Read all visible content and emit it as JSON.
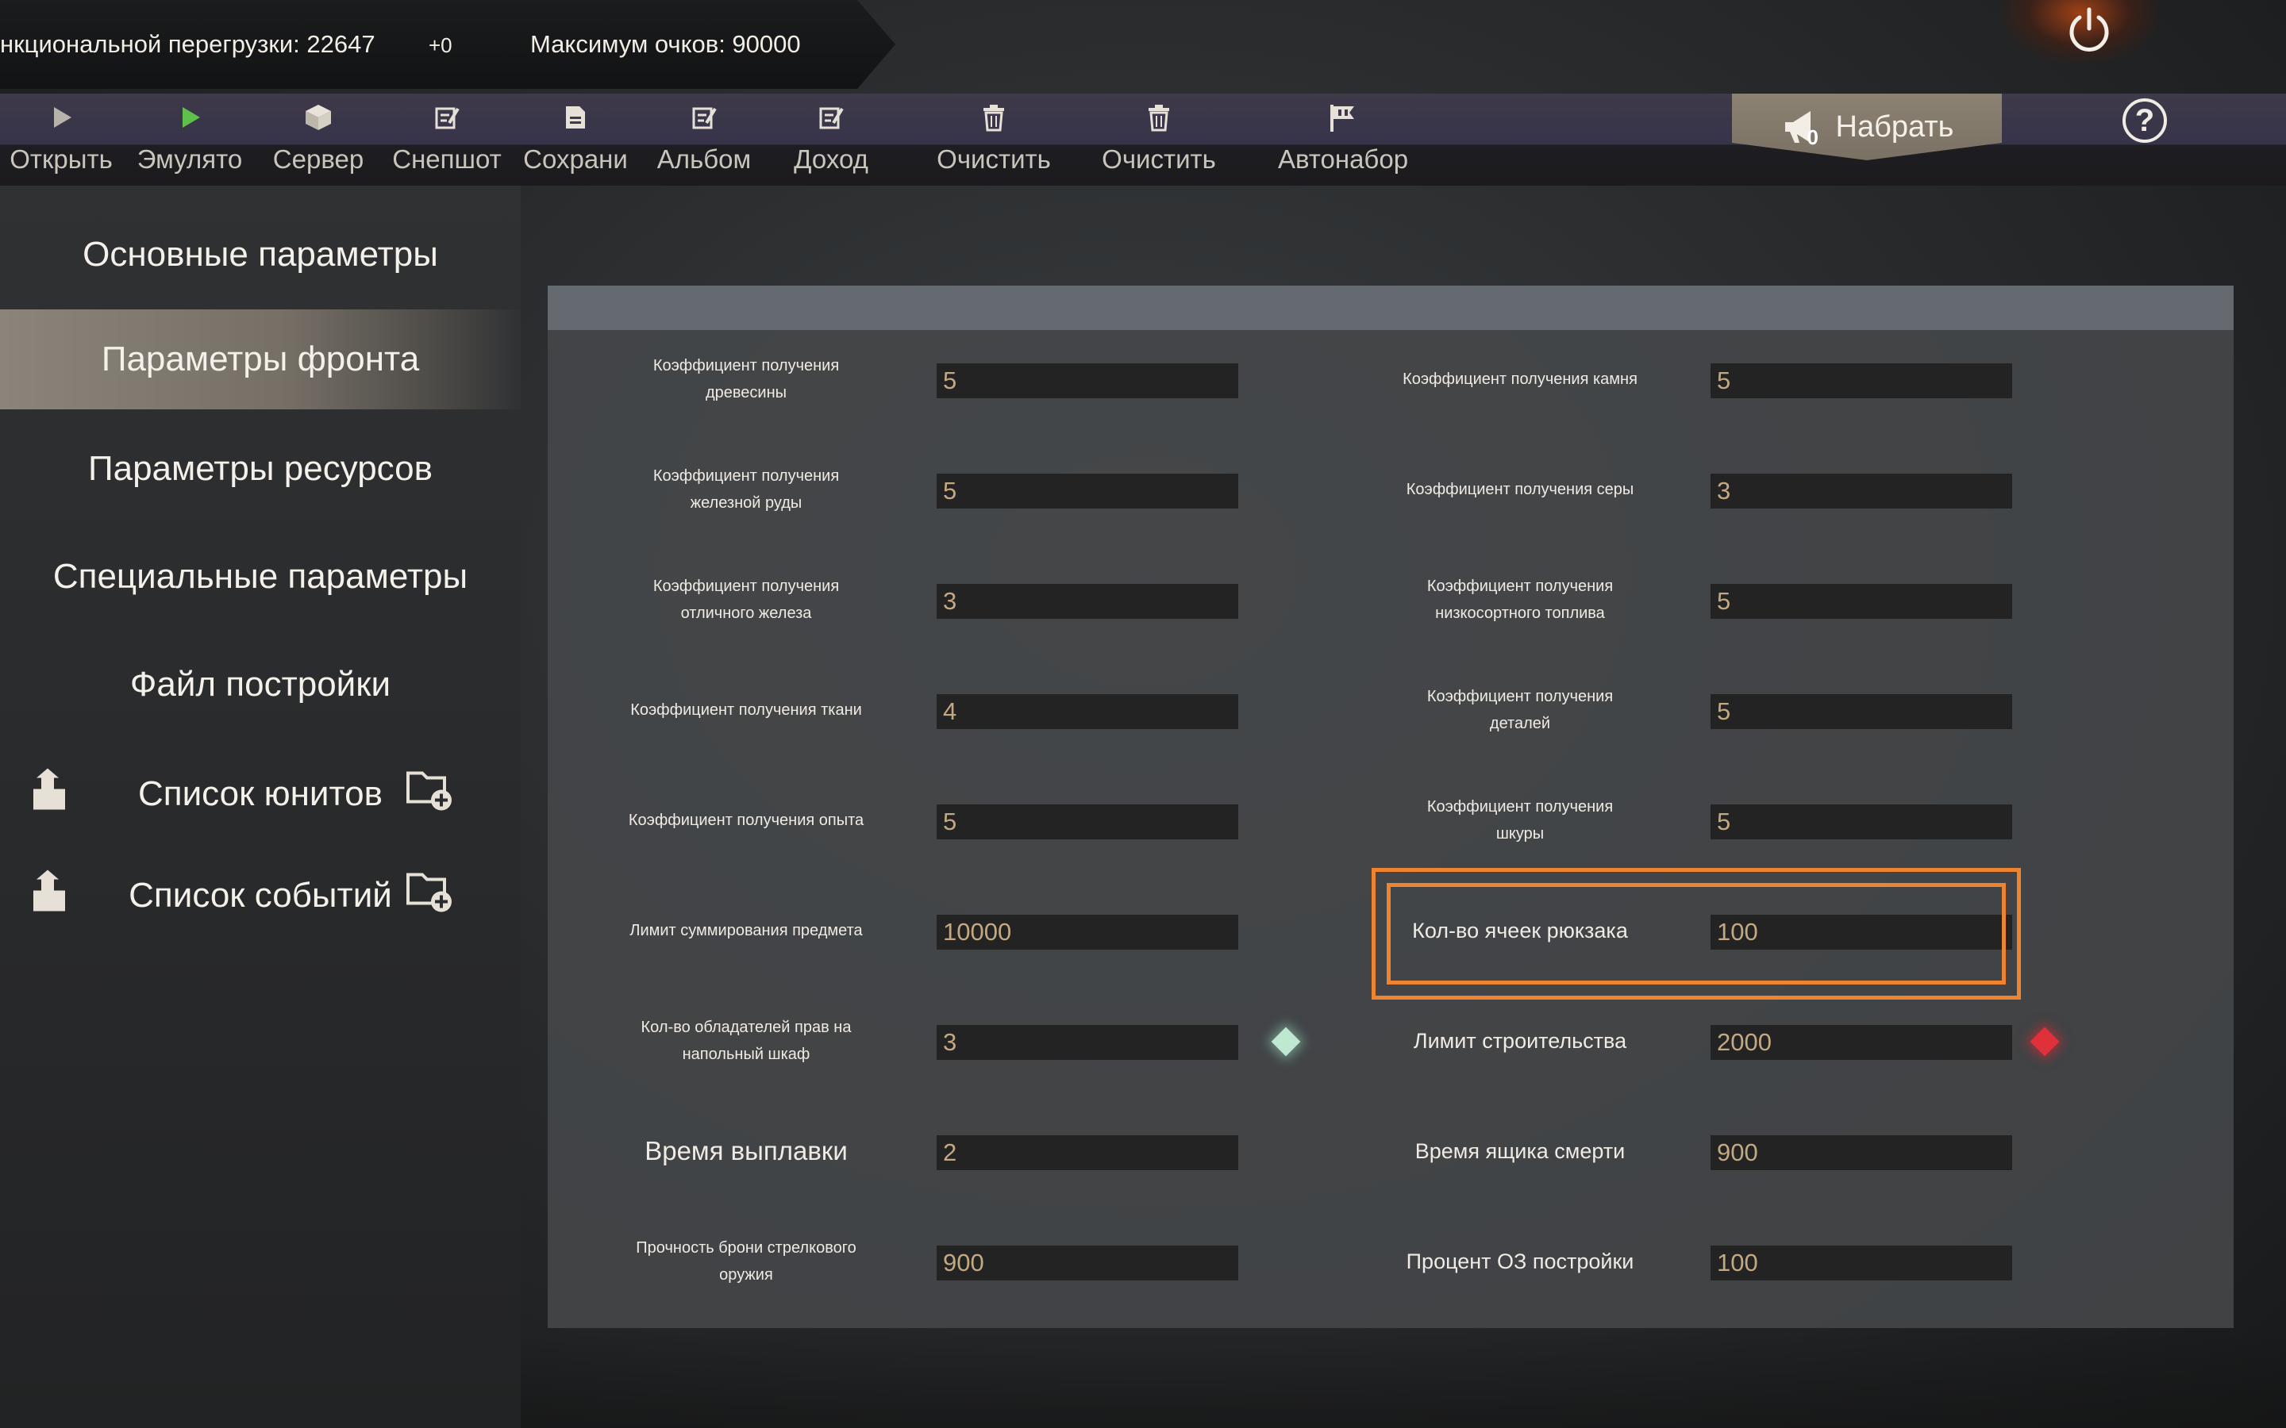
{
  "status": {
    "overload_text": "нкциональной перегрузки: 22647",
    "delta": "+0",
    "max_points": "Максимум очков: 90000"
  },
  "toolbar": {
    "items": [
      {
        "label": "Открыть",
        "icon": "play-icon"
      },
      {
        "label": "Эмулято",
        "icon": "play-green-icon"
      },
      {
        "label": "Сервер",
        "icon": "cube-icon"
      },
      {
        "label": "Снепшот",
        "icon": "edit-icon"
      },
      {
        "label": "Сохрани",
        "icon": "save-icon"
      },
      {
        "label": "Альбом",
        "icon": "edit-icon"
      },
      {
        "label": "Доход",
        "icon": "edit-icon"
      },
      {
        "label": "Очистить",
        "icon": "trash-icon"
      },
      {
        "label": "Очистить",
        "icon": "trash-icon"
      },
      {
        "label": "Автонабор",
        "icon": "flag-icon"
      }
    ],
    "recruit_label": "Набрать",
    "recruit_count": "0",
    "help_label": "?"
  },
  "sidebar": {
    "items": [
      {
        "label": "Основные параметры"
      },
      {
        "label": "Параметры фронта"
      },
      {
        "label": "Параметры ресурсов"
      },
      {
        "label": "Специальные параметры"
      },
      {
        "label": "Файл постройки"
      },
      {
        "label": "Список юнитов"
      },
      {
        "label": "Список событий"
      }
    ],
    "active_index": 1
  },
  "settings": {
    "left": [
      {
        "label": "Коэффициент получения древесины",
        "value": "5"
      },
      {
        "label": "Коэффициент получения железной руды",
        "value": "5"
      },
      {
        "label": "Коэффициент получения отличного железа",
        "value": "3"
      },
      {
        "label": "Коэффициент получения ткани",
        "value": "4"
      },
      {
        "label": "Коэффициент получения опыта",
        "value": "5"
      },
      {
        "label": "Лимит суммирования предмета",
        "value": "10000"
      },
      {
        "label": "Кол-во обладателей прав на напольный шкаф",
        "value": "3"
      },
      {
        "label": "Время выплавки",
        "value": "2"
      },
      {
        "label": "Прочность брони стрелкового оружия",
        "value": "900"
      }
    ],
    "right": [
      {
        "label": "Коэффициент получения камня",
        "value": "5"
      },
      {
        "label": "Коэффициент получения серы",
        "value": "3"
      },
      {
        "label": "Коэффициент получения низкосортного топлива",
        "value": "5"
      },
      {
        "label": "Коэффициент получения деталей",
        "value": "5"
      },
      {
        "label": "Коэффициент получения шкуры",
        "value": "5"
      },
      {
        "label": "Кол-во ячеек рюкзака",
        "value": "100"
      },
      {
        "label": "Лимит строительства",
        "value": "2000"
      },
      {
        "label": "Время ящика смерти",
        "value": "900"
      },
      {
        "label": "Процент ОЗ постройки",
        "value": "100"
      }
    ]
  },
  "colors": {
    "highlight": "#ee8430",
    "marker_green": "#bfe8d2",
    "marker_red": "#e0303a",
    "value_text": "#c3a982"
  }
}
